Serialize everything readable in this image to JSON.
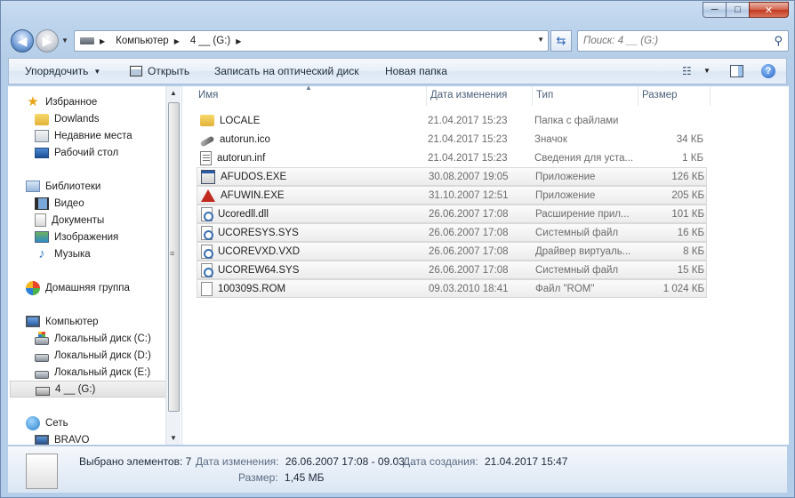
{
  "window": {
    "caption_min": "─",
    "caption_max": "□",
    "caption_close": "✕"
  },
  "address": {
    "crumbs": [
      "Компьютер",
      "4 __ (G:)"
    ],
    "search_placeholder": "Поиск: 4 __ (G:)"
  },
  "toolbar": {
    "organize": "Упорядочить",
    "open": "Открыть",
    "burn": "Записать на оптический диск",
    "new_folder": "Новая папка",
    "help": "?"
  },
  "sidebar": {
    "favorites": "Избранное",
    "dowlands": "Dowlands",
    "recent": "Недавние места",
    "desktop": "Рабочий стол",
    "libraries": "Библиотеки",
    "video": "Видео",
    "documents": "Документы",
    "images": "Изображения",
    "music": "Музыка",
    "homegroup": "Домашняя группа",
    "computer": "Компьютер",
    "disk_c": "Локальный диск (C:)",
    "disk_d": "Локальный диск (D:)",
    "disk_e": "Локальный диск (E:)",
    "disk_g": "4 __ (G:)",
    "network": "Сеть",
    "bravo": "BRAVO"
  },
  "columns": {
    "name": "Имя",
    "date": "Дата изменения",
    "type": "Тип",
    "size": "Размер"
  },
  "files": [
    {
      "name": "LOCALE",
      "date": "21.04.2017 15:23",
      "type": "Папка с файлами",
      "size": "",
      "icon": "folder",
      "selected": false
    },
    {
      "name": "autorun.ico",
      "date": "21.04.2017 15:23",
      "type": "Значок",
      "size": "34 КБ",
      "icon": "ico-file",
      "selected": false
    },
    {
      "name": "autorun.inf",
      "date": "21.04.2017 15:23",
      "type": "Сведения для уста...",
      "size": "1 КБ",
      "icon": "inf",
      "selected": false
    },
    {
      "name": "AFUDOS.EXE",
      "date": "30.08.2007 19:05",
      "type": "Приложение",
      "size": "126 КБ",
      "icon": "exe",
      "selected": true
    },
    {
      "name": "AFUWIN.EXE",
      "date": "31.10.2007 12:51",
      "type": "Приложение",
      "size": "205 КБ",
      "icon": "afuwin",
      "selected": true
    },
    {
      "name": "Ucoredll.dll",
      "date": "26.06.2007 17:08",
      "type": "Расширение прил...",
      "size": "101 КБ",
      "icon": "sys",
      "selected": true
    },
    {
      "name": "UCORESYS.SYS",
      "date": "26.06.2007 17:08",
      "type": "Системный файл",
      "size": "16 КБ",
      "icon": "sys",
      "selected": true
    },
    {
      "name": "UCOREVXD.VXD",
      "date": "26.06.2007 17:08",
      "type": "Драйвер виртуаль...",
      "size": "8 КБ",
      "icon": "sys",
      "selected": true
    },
    {
      "name": "UCOREW64.SYS",
      "date": "26.06.2007 17:08",
      "type": "Системный файл",
      "size": "15 КБ",
      "icon": "sys",
      "selected": true
    },
    {
      "name": "100309S.ROM",
      "date": "09.03.2010 18:41",
      "type": "Файл \"ROM\"",
      "size": "1 024 КБ",
      "icon": "rom",
      "selected": true
    }
  ],
  "details": {
    "selected_label": "Выбрано элементов: 7",
    "modified_label": "Дата изменения:",
    "modified_value": "26.06.2007 17:08 - 09.03....",
    "created_label": "Дата создания:",
    "created_value": "21.04.2017 15:47",
    "size_label": "Размер:",
    "size_value": "1,45 МБ"
  }
}
